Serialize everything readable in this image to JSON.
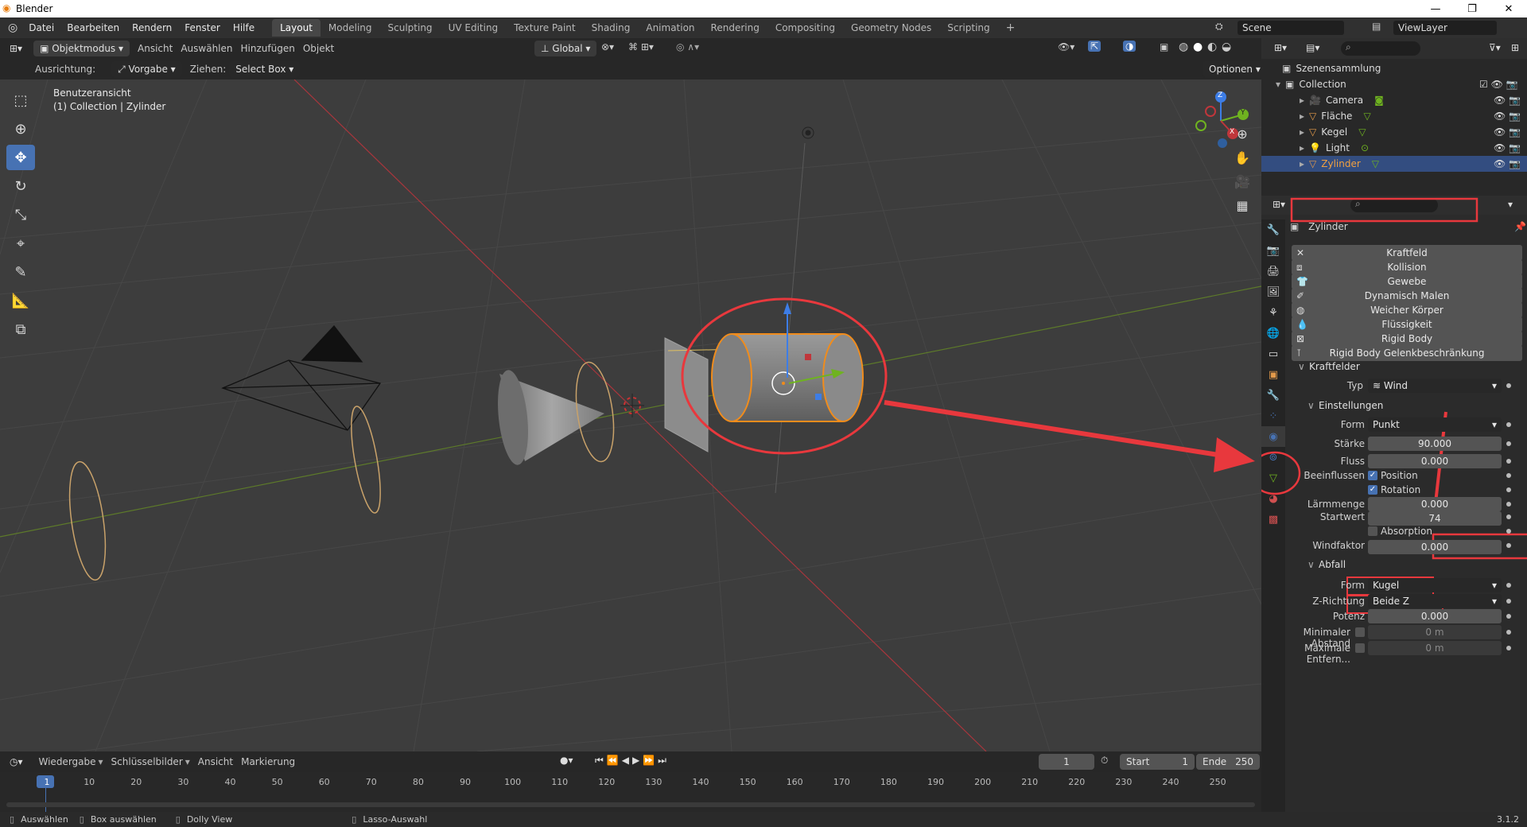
{
  "window": {
    "title": "Blender",
    "buttons": [
      "—",
      "❐",
      "✕"
    ]
  },
  "menu": [
    "Datei",
    "Bearbeiten",
    "Rendern",
    "Fenster",
    "Hilfe"
  ],
  "workspaces": [
    "Layout",
    "Modeling",
    "Sculpting",
    "UV Editing",
    "Texture Paint",
    "Shading",
    "Animation",
    "Rendering",
    "Compositing",
    "Geometry Nodes",
    "Scripting"
  ],
  "active_workspace": "Layout",
  "scene": {
    "name": "Scene",
    "viewlayer": "ViewLayer"
  },
  "viewport_header": {
    "mode": "Objektmodus",
    "menus": [
      "Ansicht",
      "Auswählen",
      "Hinzufügen",
      "Objekt"
    ],
    "orientation": "Global"
  },
  "tool_settings": {
    "ausrichtung_label": "Ausrichtung:",
    "ausrichtung_value": "Vorgabe",
    "ziehen_label": "Ziehen:",
    "ziehen_value": "Select Box",
    "options": "Optionen"
  },
  "viewport": {
    "view_name": "Benutzeransicht",
    "collection_info": "(1) Collection | Zylinder"
  },
  "gizmo": {
    "x": "X",
    "y": "Y",
    "z": "Z"
  },
  "outliner": {
    "root": "Szenensammlung",
    "collection": "Collection",
    "items": [
      "Camera",
      "Fläche",
      "Kegel",
      "Light",
      "Zylinder"
    ],
    "selected": "Zylinder"
  },
  "properties": {
    "object_name": "Zylinder",
    "physics_buttons": [
      "Kraftfeld",
      "Kollision",
      "Gewebe",
      "Dynamisch Malen",
      "Weicher Körper",
      "Flüssigkeit",
      "Rigid Body",
      "Rigid Body Gelenkbeschränkung"
    ],
    "kraftfelder_header": "Kraftfelder",
    "typ_label": "Typ",
    "typ_value": "Wind",
    "einstellungen_header": "Einstellungen",
    "form_label": "Form",
    "form_value": "Punkt",
    "staerke_label": "Stärke",
    "staerke_value": "90.000",
    "fluss_label": "Fluss",
    "fluss_value": "0.000",
    "beeinflussen_label": "Beeinflussen",
    "position_label": "Position",
    "rotation_label": "Rotation",
    "laermmenge_label": "Lärmmenge",
    "laermmenge_value": "0.000",
    "startwert_label": "Startwert",
    "startwert_value": "74",
    "absorption_label": "Absorption",
    "windfaktor_label": "Windfaktor",
    "windfaktor_value": "0.000",
    "abfall_header": "Abfall",
    "abfall_form_label": "Form",
    "abfall_form_value": "Kugel",
    "zrichtung_label": "Z-Richtung",
    "zrichtung_value": "Beide Z",
    "potenz_label": "Potenz",
    "potenz_value": "0.000",
    "min_abstand_label": "Minimaler Abstand",
    "min_abstand_value": "0 m",
    "max_entf_label": "Maximale Entfern...",
    "max_entf_value": "0 m"
  },
  "timeline": {
    "menus": [
      "Wiedergabe",
      "Schlüsselbilder",
      "Ansicht",
      "Markierung"
    ],
    "current_frame": "1",
    "start_label": "Start",
    "start_value": "1",
    "end_label": "Ende",
    "end_value": "250",
    "ticks": [
      "1",
      "10",
      "20",
      "30",
      "40",
      "50",
      "60",
      "70",
      "80",
      "90",
      "100",
      "110",
      "120",
      "130",
      "140",
      "150",
      "160",
      "170",
      "180",
      "190",
      "200",
      "210",
      "220",
      "230",
      "240",
      "250"
    ]
  },
  "statusbar": {
    "items": [
      "Auswählen",
      "Box auswählen",
      "Dolly View",
      "Lasso-Auswahl"
    ],
    "version": "3.1.2"
  },
  "annotation_color": "#e8383d"
}
